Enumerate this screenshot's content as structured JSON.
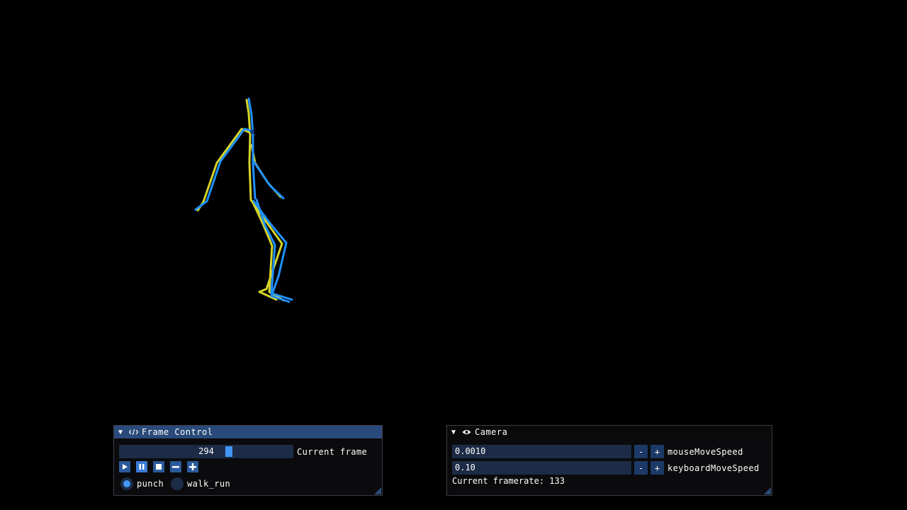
{
  "frame_control": {
    "title": "Frame Control",
    "current_frame_value": "294",
    "current_frame_fraction": 0.64,
    "current_frame_label": "Current frame",
    "buttons": [
      {
        "name": "play-button",
        "icon": "play-icon"
      },
      {
        "name": "pause-button",
        "icon": "pause-icon",
        "active": true
      },
      {
        "name": "stop-button",
        "icon": "stop-icon"
      },
      {
        "name": "previous-frame-button",
        "icon": "minus-icon"
      },
      {
        "name": "next-frame-button",
        "icon": "plus-icon"
      }
    ],
    "animations": [
      {
        "label": "punch",
        "selected": true
      },
      {
        "label": "walk_run",
        "selected": false
      }
    ]
  },
  "camera": {
    "title": "Camera",
    "mouse_move_speed": {
      "value": "0.0010",
      "label": "mouseMoveSpeed"
    },
    "keyboard_move_speed": {
      "value": "0.10",
      "label": "keyboardMoveSpeed"
    },
    "decrement_label": "-",
    "increment_label": "+",
    "framerate_text": "Current framerate: 133"
  },
  "colors": {
    "skeleton_primary": "#1e90ff",
    "skeleton_secondary": "#d4d42a",
    "accent": "#4196f5",
    "title_active": "#294a7a",
    "frame_bg": "#1c2c46"
  }
}
